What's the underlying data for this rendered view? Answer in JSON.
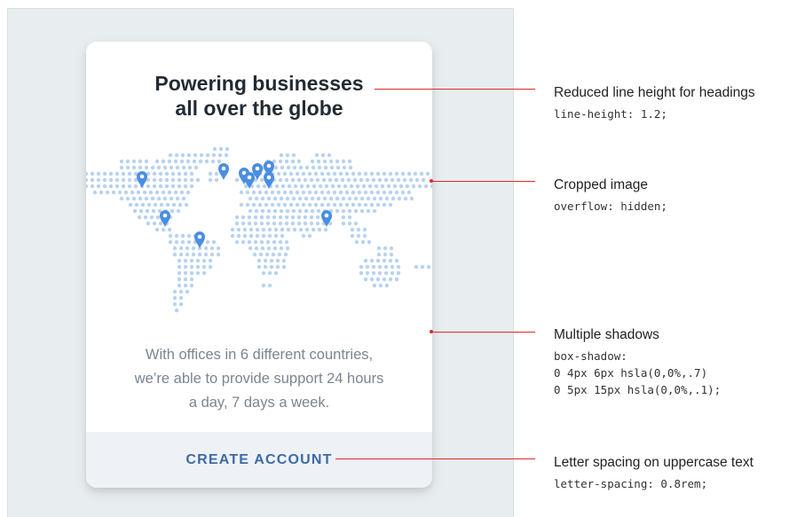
{
  "card": {
    "title": "Powering businesses\nall over the globe",
    "body": "With offices in 6 different countries,\nwe’re able to provide support 24 hours\na day, 7 days a week.",
    "cta_label": "CREATE ACCOUNT"
  },
  "annotations": [
    {
      "label": "Reduced line height for headings",
      "code": "line-height: 1.2;"
    },
    {
      "label": "Cropped image",
      "code": "overflow: hidden;"
    },
    {
      "label": "Multiple shadows",
      "code": "box-shadow:\n0 4px 6px hsla(0,0%,.7)\n0 5px 15px hsla(0,0%,.1);"
    },
    {
      "label": "Letter spacing on uppercase text",
      "code": "letter-spacing: 0.8rem;"
    }
  ],
  "colors": {
    "accent_line": "#e0262f",
    "map_dot": "#b8d2ef",
    "pin": "#4a8ee0",
    "cta_text": "#3d6aa6",
    "cta_bg": "#eef2f6"
  },
  "icons": {
    "marker": "map-pin-icon"
  }
}
